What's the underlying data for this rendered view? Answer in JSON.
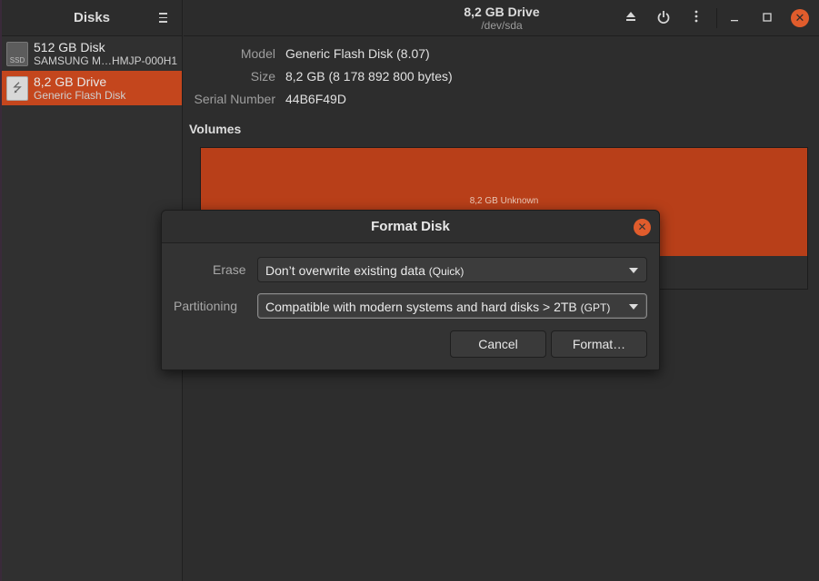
{
  "sidebar": {
    "title": "Disks",
    "menu_icon": "hamburger-menu-icon",
    "drives": [
      {
        "name": "512 GB Disk",
        "subtitle": "SAMSUNG M…HMJP-000H1",
        "icon": "ssd-icon",
        "icon_text": "SSD",
        "selected": false
      },
      {
        "name": "8,2 GB Drive",
        "subtitle": "Generic Flash Disk",
        "icon": "usb-drive-icon",
        "icon_text": "",
        "selected": true
      }
    ]
  },
  "header": {
    "title": "8,2 GB Drive",
    "subtitle": "/dev/sda",
    "icons": [
      "eject-icon",
      "power-icon",
      "more-options-icon",
      "minimize-icon",
      "maximize-icon",
      "close-icon"
    ]
  },
  "drive_info": {
    "model_label": "Model",
    "model_value": "Generic Flash Disk (8.07)",
    "size_label": "Size",
    "size_value": "8,2 GB (8 178 892 800 bytes)",
    "serial_label": "Serial Number",
    "serial_value": "44B6F49D"
  },
  "volumes": {
    "title": "Volumes",
    "bar_label": "8,2 GB Unknown"
  },
  "dialog": {
    "title": "Format Disk",
    "erase_label": "Erase",
    "erase_value": "Don’t overwrite existing data",
    "erase_value_suffix": "(Quick)",
    "partitioning_label": "Partitioning",
    "partitioning_value": "Compatible with modern systems and hard disks > 2TB",
    "partitioning_value_suffix": "(GPT)",
    "cancel_label": "Cancel",
    "format_label": "Format…"
  },
  "colors": {
    "accent": "#c4461d",
    "volume_bar": "#b83f19",
    "close_button": "#e05c2c"
  }
}
